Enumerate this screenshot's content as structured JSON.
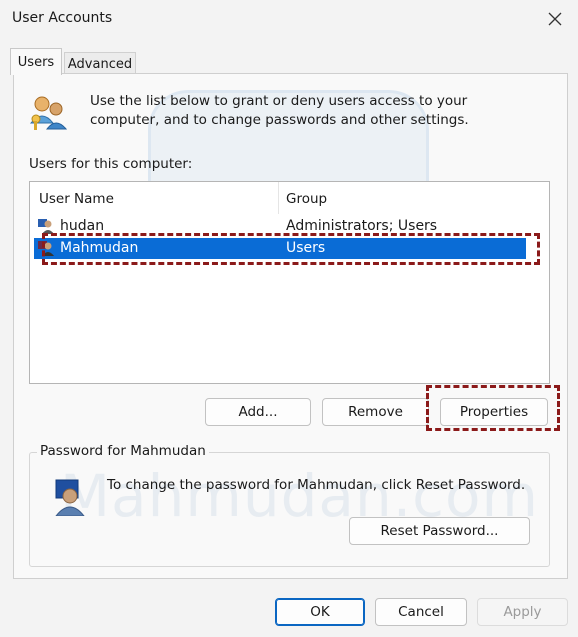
{
  "window": {
    "title": "User Accounts"
  },
  "tabs": [
    {
      "label": "Users",
      "active": true
    },
    {
      "label": "Advanced",
      "active": false
    }
  ],
  "intro_text": "Use the list below to grant or deny users access to your computer, and to change passwords and other settings.",
  "users_label": "Users for this computer:",
  "table": {
    "columns": [
      "User Name",
      "Group"
    ],
    "rows": [
      {
        "name": "hudan",
        "group": "Administrators; Users",
        "selected": false
      },
      {
        "name": "Mahmudan",
        "group": "Users",
        "selected": true
      }
    ]
  },
  "buttons": {
    "add": "Add...",
    "remove": "Remove",
    "properties": "Properties",
    "reset_password": "Reset Password...",
    "ok": "OK",
    "cancel": "Cancel",
    "apply": "Apply"
  },
  "password_group": {
    "title": "Password for Mahmudan",
    "text": "To change the password for Mahmudan, click Reset Password."
  },
  "watermark": "Mahmudan.com",
  "colors": {
    "selection": "#0a6cd6",
    "highlight": "#8b1a1a",
    "ok_border": "#0a66c2"
  },
  "icons": [
    "close-icon",
    "users-icon",
    "user-icon",
    "password-user-icon"
  ]
}
